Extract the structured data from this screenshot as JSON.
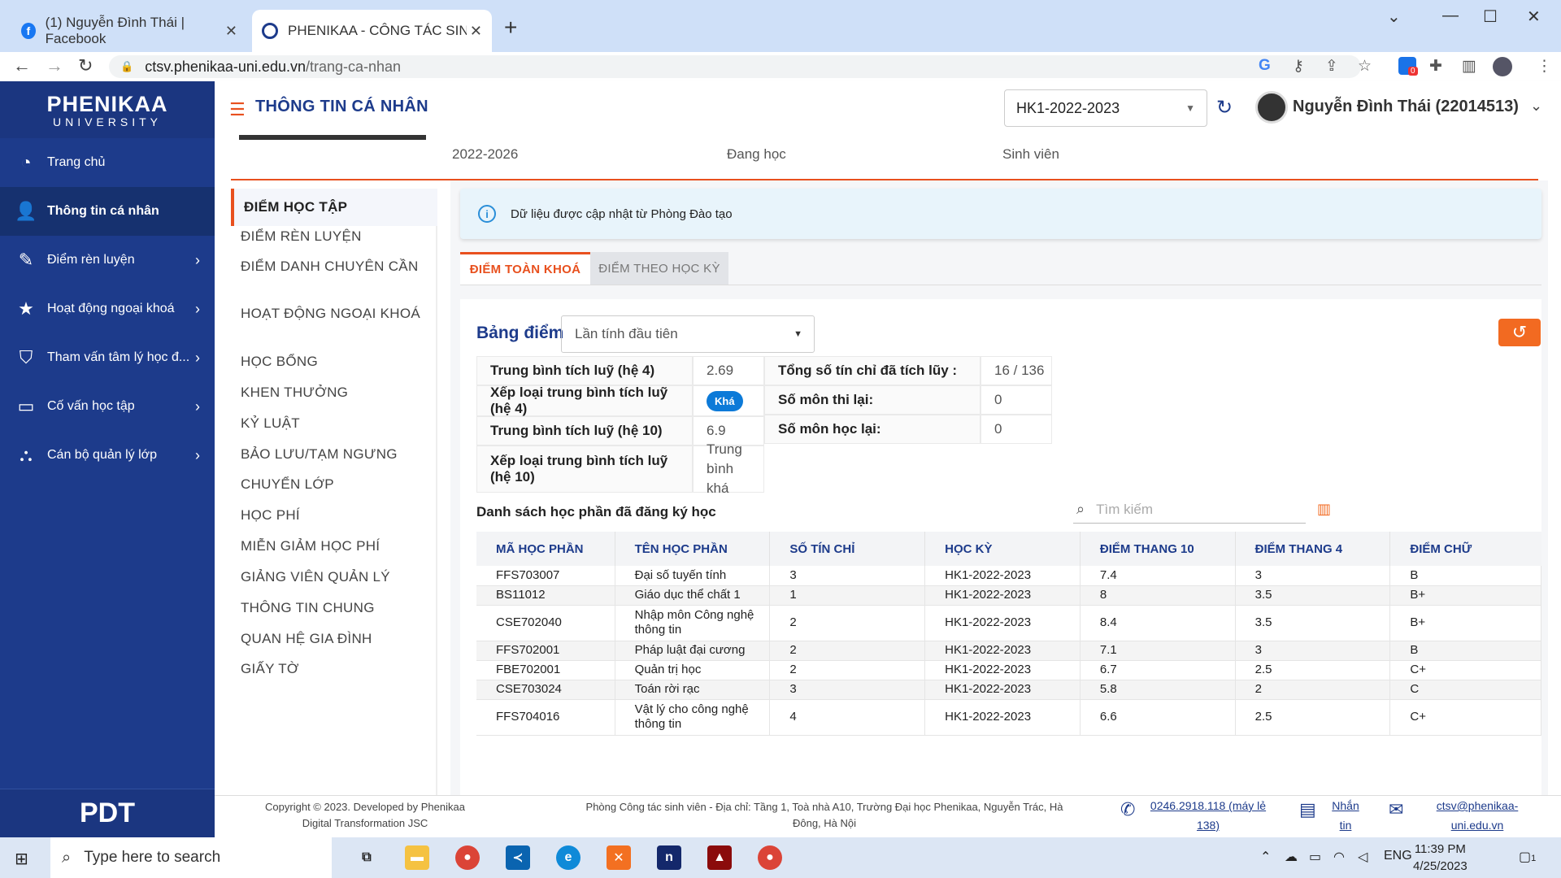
{
  "browser": {
    "tabs": [
      {
        "title": "(1) Nguyễn Đình Thái | Facebook"
      },
      {
        "title": "PHENIKAA - CÔNG TÁC SINH VIÊ"
      }
    ],
    "url_domain": "ctsv.phenikaa-uni.edu.vn",
    "url_path": "/trang-ca-nhan",
    "ext_badge": "0"
  },
  "sidebar": {
    "logo_top": "PHENIKAA",
    "logo_bottom": "UNIVERSITY",
    "items": [
      {
        "label": "Trang chủ",
        "icon": "dashboard-icon"
      },
      {
        "label": "Thông tin cá nhân",
        "icon": "user-icon"
      },
      {
        "label": "Điểm rèn luyện",
        "icon": "pen-icon"
      },
      {
        "label": "Hoạt động ngoại khoá",
        "icon": "star-icon"
      },
      {
        "label": "Tham vấn tâm lý học đ...",
        "icon": "heart-shield-icon"
      },
      {
        "label": "Cố vấn học tập",
        "icon": "teacher-icon"
      },
      {
        "label": "Cán bộ quản lý lớp",
        "icon": "group-icon"
      }
    ],
    "footer_logo": "PDT"
  },
  "header": {
    "title": "THÔNG TIN CÁ NHÂN",
    "semester": "HK1-2022-2023",
    "user": "Nguyễn Đình Thái (22014513)"
  },
  "profile": {
    "course": "2022-2026",
    "status": "Đang học",
    "role": "Sinh viên"
  },
  "left_menu": [
    "ĐIỂM HỌC TẬP",
    "ĐIỂM RÈN LUYỆN",
    "ĐIỂM DANH CHUYÊN CẦN",
    "HOẠT ĐỘNG NGOẠI KHOÁ",
    "HỌC BỔNG",
    "KHEN THƯỞNG",
    "KỶ LUẬT",
    "BẢO LƯU/TẠM NGƯNG",
    "CHUYỂN LỚP",
    "HỌC PHÍ",
    "MIỄN GIẢM HỌC PHÍ",
    "GIẢNG VIÊN QUẢN LÝ",
    "THÔNG TIN CHUNG",
    "QUAN HỆ GIA ĐÌNH",
    "GIẤY TỜ"
  ],
  "info": "Dữ liệu được cập nhật từ Phòng Đào tạo",
  "tabs": [
    "ĐIỂM TOÀN KHOÁ",
    "ĐIỂM THEO HỌC KỲ"
  ],
  "scoreboard": {
    "title": "Bảng điểm",
    "mode": "Lần tính đầu tiên",
    "left": [
      {
        "k": "Trung bình tích luỹ (hệ 4)",
        "v": "2.69"
      },
      {
        "k": "Xếp loại trung bình tích luỹ (hệ 4)",
        "v": "Khá"
      },
      {
        "k": "Trung bình tích luỹ (hệ 10)",
        "v": "6.9"
      },
      {
        "k": "Xếp loại trung bình tích luỹ (hệ 10)",
        "v": "Trung bình khá"
      }
    ],
    "right": [
      {
        "k": "Tổng số tín chỉ đã tích lũy :",
        "v": "16 / 136"
      },
      {
        "k": "Số môn thi lại:",
        "v": "0"
      },
      {
        "k": "Số môn học lại:",
        "v": "0"
      }
    ]
  },
  "courses": {
    "title": "Danh sách học phần đã đăng ký học",
    "search_placeholder": "Tìm kiếm",
    "headers": [
      "MÃ HỌC PHẦN",
      "TÊN HỌC PHẦN",
      "SỐ TÍN CHỈ",
      "HỌC KỲ",
      "ĐIỂM THANG 10",
      "ĐIỂM THANG 4",
      "ĐIỂM CHỮ"
    ],
    "rows": [
      [
        "FFS703007",
        "Đại số tuyến tính",
        "3",
        "HK1-2022-2023",
        "7.4",
        "3",
        "B"
      ],
      [
        "BS11012",
        "Giáo dục thể chất 1",
        "1",
        "HK1-2022-2023",
        "8",
        "3.5",
        "B+"
      ],
      [
        "CSE702040",
        "Nhập môn Công nghệ thông tin",
        "2",
        "HK1-2022-2023",
        "8.4",
        "3.5",
        "B+"
      ],
      [
        "FFS702001",
        "Pháp luật đại cương",
        "2",
        "HK1-2022-2023",
        "7.1",
        "3",
        "B"
      ],
      [
        "FBE702001",
        "Quản trị học",
        "2",
        "HK1-2022-2023",
        "6.7",
        "2.5",
        "C+"
      ],
      [
        "CSE703024",
        "Toán rời rạc",
        "3",
        "HK1-2022-2023",
        "5.8",
        "2",
        "C"
      ],
      [
        "FFS704016",
        "Vật lý cho công nghệ thông tin",
        "4",
        "HK1-2022-2023",
        "6.6",
        "2.5",
        "C+"
      ]
    ]
  },
  "footer": {
    "copyright": "Copyright © 2023. Developed by Phenikaa Digital Transformation JSC",
    "address": "Phòng Công tác sinh viên - Địa chỉ: Tầng 1, Toà nhà A10, Trường Đại học Phenikaa, Nguyễn Trác, Hà Đông, Hà Nội",
    "phone": "0246.2918.118 (máy lẻ 138)",
    "chat": "Nhắn tin",
    "email": "ctsv@phenikaa-uni.edu.vn"
  },
  "taskbar": {
    "search": "Type here to search",
    "lang": "ENG",
    "time": "11:39 PM",
    "date": "4/25/2023",
    "notif": "1"
  }
}
